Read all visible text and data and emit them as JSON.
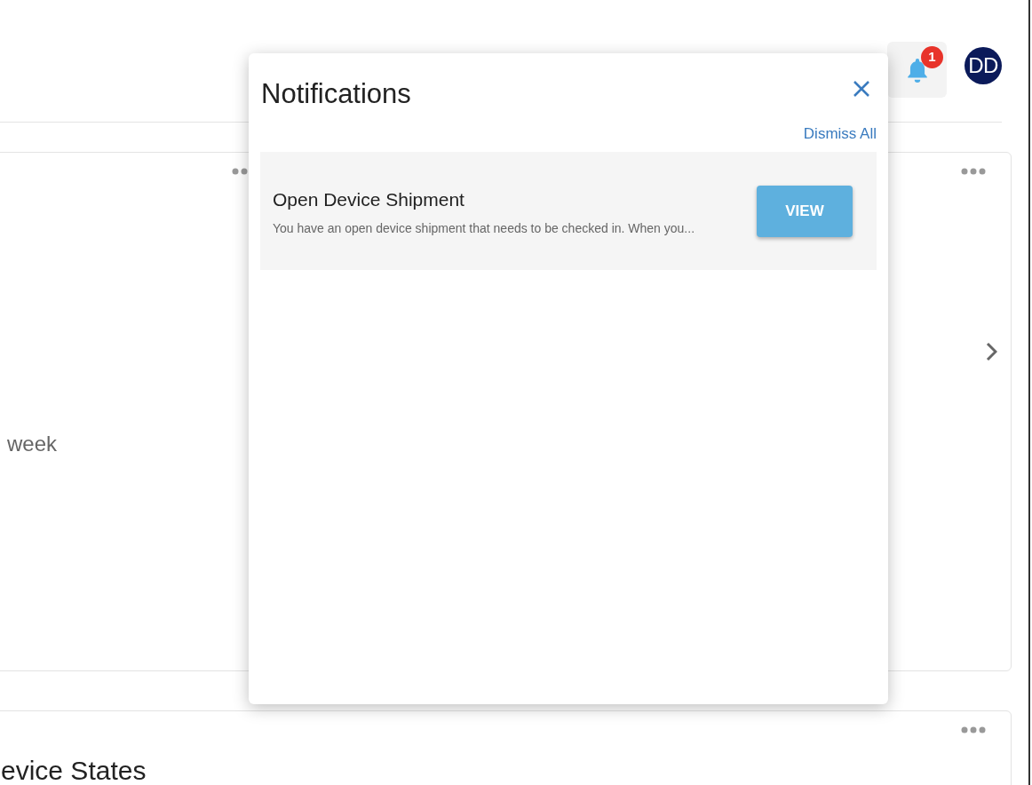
{
  "header": {
    "notifications": {
      "badge": "1"
    },
    "avatar": {
      "initials": "DD"
    }
  },
  "cards": [
    {
      "text": "week"
    },
    {
      "title": "evice States"
    }
  ],
  "notifications_panel": {
    "title": "Notifications",
    "dismiss_all": "Dismiss All",
    "items": [
      {
        "title": "Open Device Shipment",
        "message": "You have an open device shipment that needs to be checked in. When you...",
        "action": "VIEW"
      }
    ]
  }
}
